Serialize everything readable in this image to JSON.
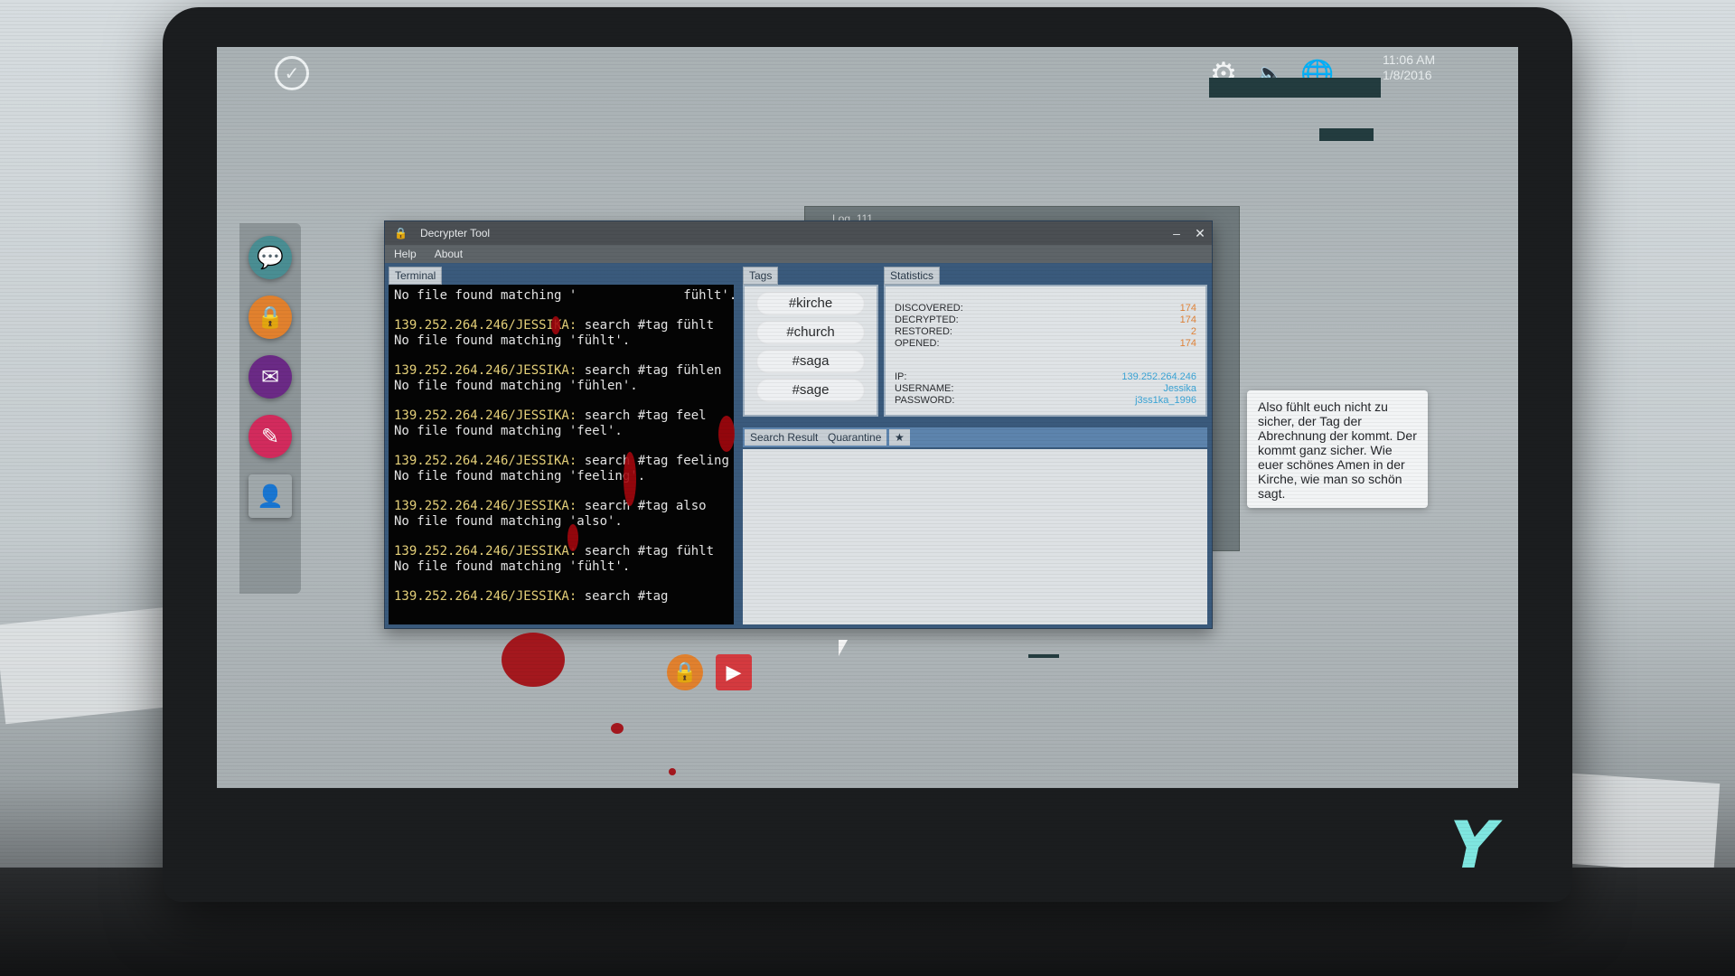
{
  "desktop": {
    "clock_time": "11:06 AM",
    "clock_date": "1/8/2016"
  },
  "back_window": {
    "title": "Log_111"
  },
  "decrypter": {
    "title": "Decrypter Tool",
    "menu": [
      "Help",
      "About"
    ],
    "terminal_tab": "Terminal",
    "tags_tab": "Tags",
    "statistics_tab": "Statistics",
    "terminal_lines": [
      {
        "prompt": "",
        "text": "No file found matching '              fühlt'."
      },
      {
        "prompt": "139.252.264.246/JESSIKA:",
        "text": " search #tag fühlt"
      },
      {
        "prompt": "",
        "text": "No file found matching 'fühlt'."
      },
      {
        "prompt": "139.252.264.246/JESSIKA:",
        "text": " search #tag fühlen"
      },
      {
        "prompt": "",
        "text": "No file found matching 'fühlen'."
      },
      {
        "prompt": "139.252.264.246/JESSIKA:",
        "text": " search #tag feel"
      },
      {
        "prompt": "",
        "text": "No file found matching 'feel'."
      },
      {
        "prompt": "139.252.264.246/JESSIKA:",
        "text": " search #tag feeling"
      },
      {
        "prompt": "",
        "text": "No file found matching 'feeling'."
      },
      {
        "prompt": "139.252.264.246/JESSIKA:",
        "text": " search #tag also"
      },
      {
        "prompt": "",
        "text": "No file found matching 'also'."
      },
      {
        "prompt": "139.252.264.246/JESSIKA:",
        "text": " search #tag fühlt"
      },
      {
        "prompt": "",
        "text": "No file found matching 'fühlt'."
      },
      {
        "prompt": "139.252.264.246/JESSIKA:",
        "text": " search #tag"
      }
    ],
    "tags": [
      "#kirche",
      "#church",
      "#saga",
      "#sage"
    ],
    "stats": {
      "discovered_label": "DISCOVERED:",
      "discovered": "174",
      "decrypted_label": "DECRYPTED:",
      "decrypted": "174",
      "restored_label": "RESTORED:",
      "restored": "2",
      "opened_label": "OPENED:",
      "opened": "174",
      "ip_label": "IP:",
      "ip": "139.252.264.246",
      "username_label": "USERNAME:",
      "username": "Jessika",
      "password_label": "PASSWORD:",
      "password": "j3ss1ka_1996"
    },
    "result_tabs": [
      "Search Result",
      "Quarantine"
    ]
  },
  "speech_bubble": "Also fühlt euch nicht zu sicher, der Tag der Abrechnung der kommt. Der kommt ganz sicher. Wie euer schönes Amen in der Kirche, wie man so schön sagt.",
  "colors": {
    "prompt": "#e7d27a",
    "accent_orange": "#e0843a",
    "accent_blue": "#3aa4d6",
    "brand": "#7fe6e0"
  }
}
